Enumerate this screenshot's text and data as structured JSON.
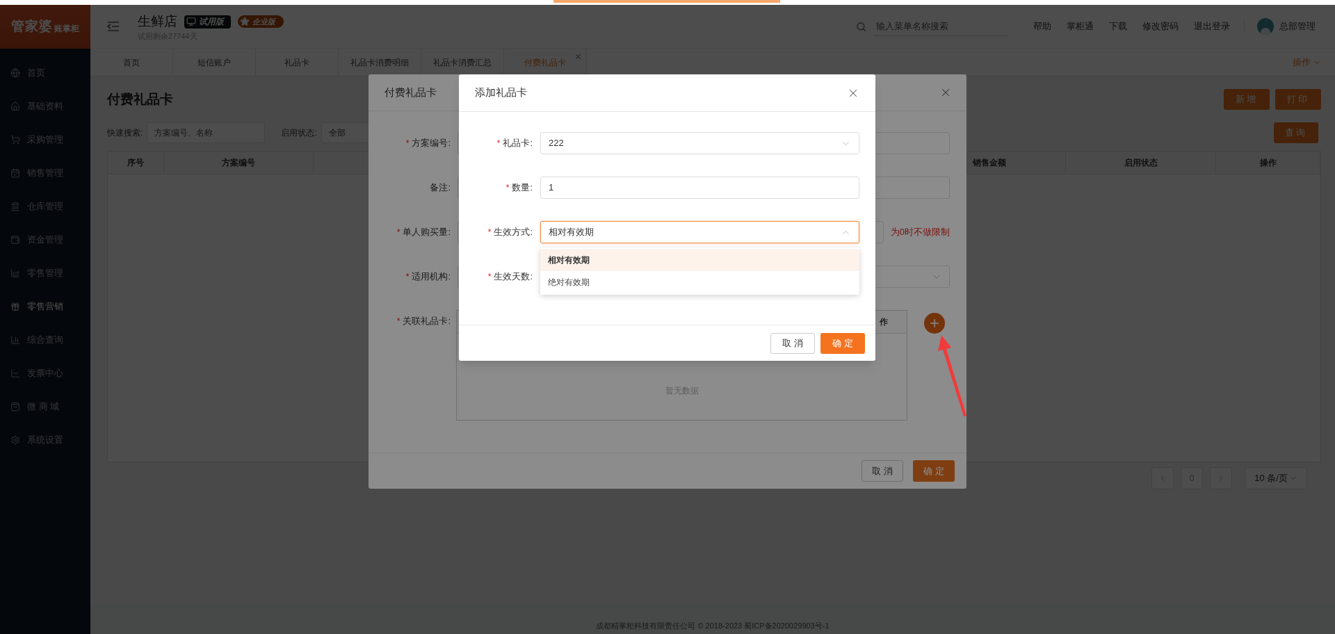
{
  "sidebar": {
    "logo": {
      "main": "管家婆",
      "sub": "账掌柜"
    },
    "items": [
      {
        "label": "首页",
        "selected": false
      },
      {
        "label": "基础资料",
        "selected": false
      },
      {
        "label": "采购管理",
        "selected": false
      },
      {
        "label": "销售管理",
        "selected": false
      },
      {
        "label": "仓库管理",
        "selected": false
      },
      {
        "label": "资金管理",
        "selected": false
      },
      {
        "label": "零售管理",
        "selected": false
      },
      {
        "label": "零售营销",
        "selected": true
      },
      {
        "label": "综合查询",
        "selected": false
      },
      {
        "label": "发票中心",
        "selected": false
      },
      {
        "label": "微 商 城",
        "selected": false
      },
      {
        "label": "系统设置",
        "selected": false
      }
    ]
  },
  "header": {
    "store_name": "生鲜店",
    "badges": [
      {
        "label": "试用版",
        "kind": "trial"
      },
      {
        "label": "企业版",
        "kind": "enterprise"
      }
    ],
    "trial_note": "试用剩余27744天",
    "search": {
      "placeholder": "输入菜单名称搜索"
    },
    "links": [
      "帮助",
      "掌柜通",
      "下载",
      "修改密码",
      "退出登录"
    ],
    "user": "总部管理"
  },
  "tabs": [
    {
      "label": "首页",
      "selected": false,
      "closable": false
    },
    {
      "label": "短信账户",
      "selected": false,
      "closable": false
    },
    {
      "label": "礼品卡",
      "selected": false,
      "closable": false
    },
    {
      "label": "礼品卡消费明细",
      "selected": false,
      "closable": false
    },
    {
      "label": "礼品卡消费汇总",
      "selected": false,
      "closable": false
    },
    {
      "label": "付费礼品卡",
      "selected": true,
      "closable": true
    }
  ],
  "tab_actions": "操作",
  "page": {
    "title": "付费礼品卡",
    "buttons": [
      "新增",
      "打印"
    ],
    "filters": {
      "search_label": "快速搜索:",
      "search_placeholder": "方案编号、名称",
      "status_label": "启用状态:",
      "status_value": "全部"
    },
    "query_button": "查询",
    "table": {
      "columns": [
        "序号",
        "方案编号",
        "销售金额",
        "启用状态",
        "操作"
      ]
    },
    "pagination": {
      "page": "0",
      "page_size": "10 条/页"
    }
  },
  "footer": "成都精掌柜科技有限责任公司 © 2018-2023 蜀ICP备2020029903号-1",
  "dialog": {
    "title": "付费礼品卡",
    "fields": [
      {
        "label": "方案编号:",
        "mark": "*",
        "kind": "input"
      },
      {
        "label": "备注:",
        "kind": "input"
      },
      {
        "label": "单人购买量:",
        "mark": "*",
        "kind": "input",
        "hint": "为0时不做限制"
      },
      {
        "label": "适用机构:",
        "mark": "*",
        "kind": "select"
      },
      {
        "label": "关联礼品卡:",
        "mark": "*",
        "kind": "table",
        "column": "作",
        "empty_text": "暂无数据"
      }
    ],
    "buttons": [
      {
        "label": "取 消",
        "primary": false
      },
      {
        "label": "确 定",
        "primary": true
      }
    ]
  },
  "subdialog": {
    "title": "添加礼品卡",
    "fields": [
      {
        "label": "礼品卡:",
        "mark": "*",
        "kind": "select",
        "value": "222",
        "open": false
      },
      {
        "label": "数量:",
        "mark": "*",
        "kind": "input",
        "value": "1"
      },
      {
        "label": "生效方式:",
        "mark": "*",
        "kind": "select",
        "value": "相对有效期",
        "open": true,
        "options": [
          {
            "label": "相对有效期",
            "selected": true
          },
          {
            "label": "绝对有效期",
            "selected": false
          }
        ]
      },
      {
        "label": "生效天数:",
        "mark": "*"
      }
    ],
    "buttons": [
      {
        "label": "取 消",
        "primary": false
      },
      {
        "label": "确 定",
        "primary": true
      }
    ]
  }
}
